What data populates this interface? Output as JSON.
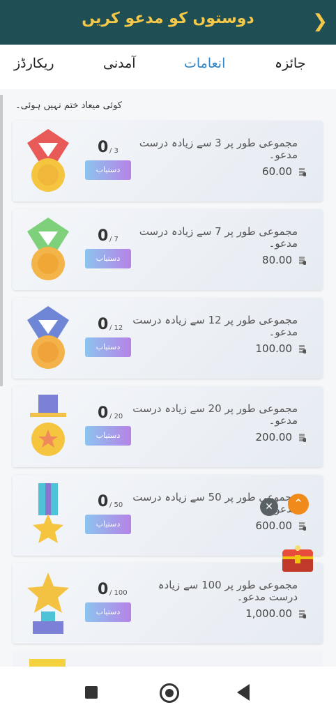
{
  "header": {
    "title": "دوستوں کو مدعو کریں",
    "back_icon": "chevron-right-icon"
  },
  "tabs": [
    {
      "label": "ریکارڈز"
    },
    {
      "label": "آمدنی"
    },
    {
      "label": "انعامات",
      "active": true
    },
    {
      "label": "جائزہ"
    }
  ],
  "notice": "کوئی میعاد ختم نہیں ہوئی۔",
  "button_label": "دستیاب",
  "cards": [
    {
      "desc": "مجموعی طور پر 3 سے زیادہ درست مدعو۔",
      "count": "0",
      "total": "/ 3",
      "reward": "60.00",
      "medal_color": "#e85a57"
    },
    {
      "desc": "مجموعی طور پر 7 سے زیادہ درست مدعو۔",
      "count": "0",
      "total": "/ 7",
      "reward": "80.00",
      "medal_color": "#7fd07a"
    },
    {
      "desc": "مجموعی طور پر 12 سے زیادہ درست مدعو۔",
      "count": "0",
      "total": "/ 12",
      "reward": "100.00",
      "medal_color": "#6f86d6"
    },
    {
      "desc": "مجموعی طور پر 20 سے زیادہ درست مدعو۔",
      "count": "0",
      "total": "/ 20",
      "reward": "200.00",
      "medal_color": "#7c80d6"
    },
    {
      "desc": "مجموعی طور پر 50 سے زیادہ درست مدعو۔",
      "count": "0",
      "total": "/ 50",
      "reward": "600.00",
      "medal_color": "#4ec3d8"
    },
    {
      "desc": "مجموعی طور پر 100 سے زیادہ درست مدعو۔",
      "count": "0",
      "total": "/ 100",
      "reward": "1,000.00",
      "medal_color": "#f4c243"
    }
  ],
  "floating": {
    "up_icon": "double-chevron-up-icon",
    "close_icon": "close-icon",
    "chest_icon": "treasure-chest-icon"
  },
  "nav": {
    "recents_icon": "square-icon",
    "home_icon": "circle-home-icon",
    "back_icon": "triangle-back-icon"
  }
}
